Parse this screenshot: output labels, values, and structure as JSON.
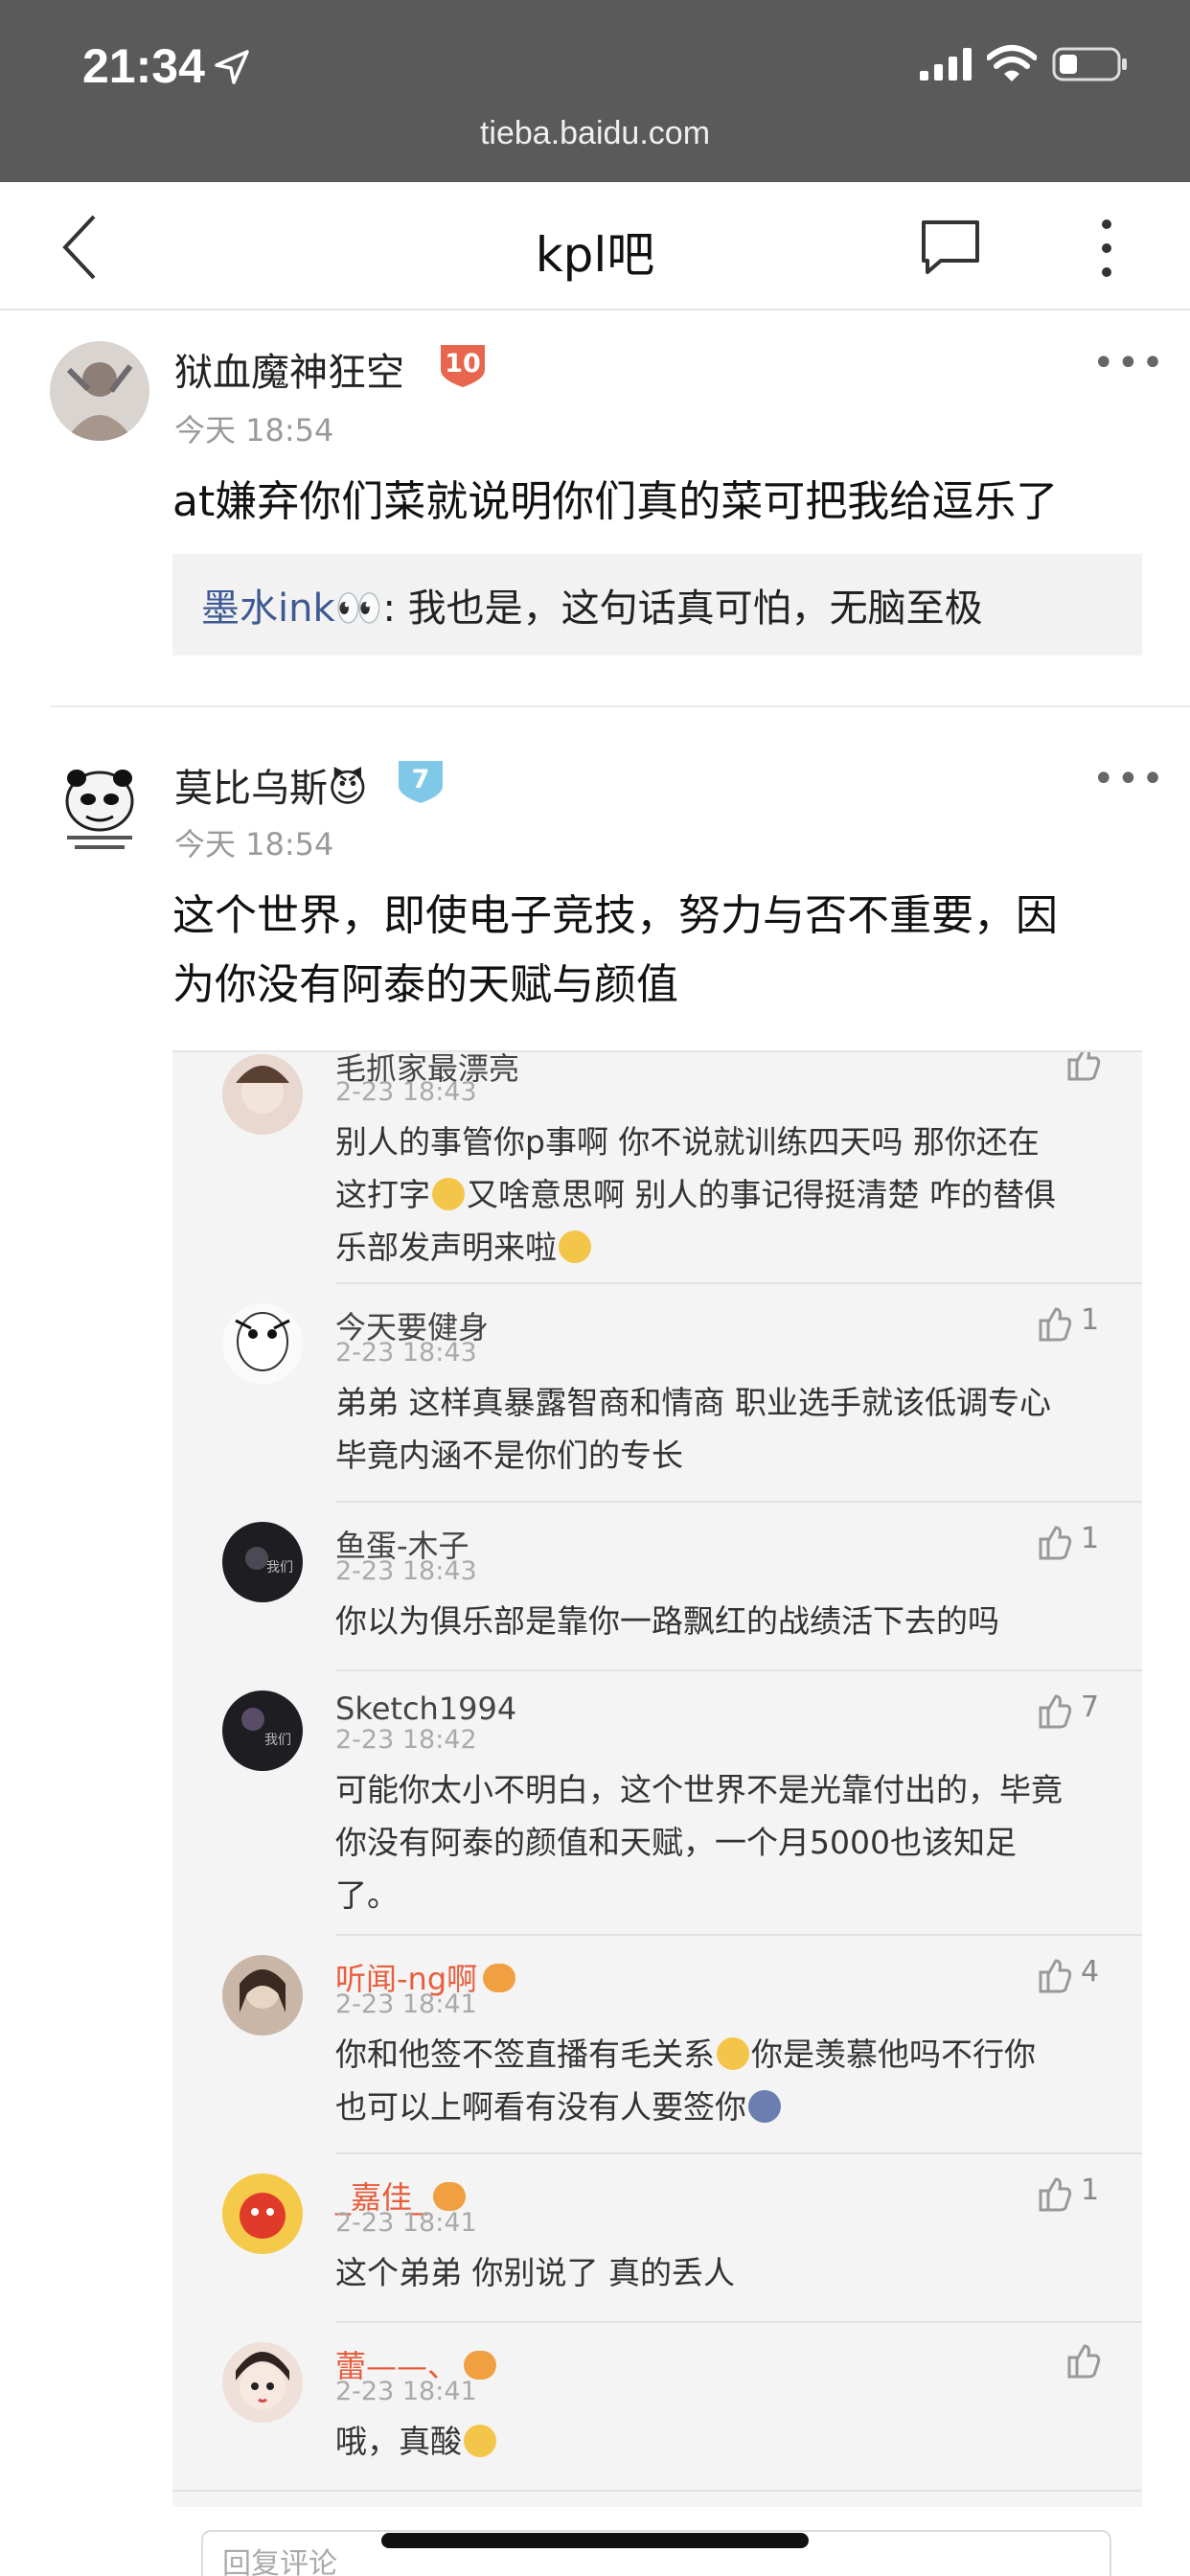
{
  "status_bar": {
    "time": "21:34",
    "url": "tieba.baidu.com"
  },
  "nav": {
    "title": "kpl吧"
  },
  "posts": [
    {
      "username": "狱血魔神狂空",
      "level": "10",
      "time": "今天 18:54",
      "text": "at嫌弃你们菜就说明你们真的菜可把我给逗乐了",
      "quote": {
        "name": "墨水ink👀",
        "text": ": 我也是，这句话真可怕，无脑至极"
      }
    },
    {
      "username": "莫比乌斯😈",
      "level": "7",
      "time": "今天 18:54",
      "text_line1": "这个世界，即使电子竞技，努力与否不重要，因",
      "text_line2": "为你没有阿泰的天赋与颜值"
    }
  ],
  "embedded_comments": [
    {
      "name": "毛抓家最漂亮",
      "time": "2-23 18:43",
      "likes": "",
      "lines": [
        "别人的事管你p事啊 你不说就训练四天吗 那你还在",
        "这打字",
        "又啥意思啊 别人的事记得挺清楚 咋的替俱",
        "乐部发声明来啦"
      ]
    },
    {
      "name": "今天要健身",
      "time": "2-23 18:43",
      "likes": "1",
      "lines": [
        "弟弟 这样真暴露智商和情商 职业选手就该低调专心",
        "毕竟内涵不是你们的专长"
      ]
    },
    {
      "name": "鱼蛋-木子",
      "time": "2-23 18:43",
      "likes": "1",
      "lines": [
        "你以为俱乐部是靠你一路飘红的战绩活下去的吗"
      ]
    },
    {
      "name": "Sketch1994",
      "time": "2-23 18:42",
      "likes": "7",
      "lines": [
        "可能你太小不明白，这个世界不是光靠付出的，毕竟",
        "你没有阿泰的颜值和天赋，一个月5000也该知足",
        "了。"
      ]
    },
    {
      "name": "听闻-ng啊",
      "time": "2-23 18:41",
      "likes": "4",
      "lines": [
        "你和他签不签直播有毛关系",
        "你是羡慕他吗不行你",
        "也可以上啊看有没有人要签你"
      ]
    },
    {
      "name": "_嘉佳_",
      "time": "2-23 18:41",
      "likes": "1",
      "lines": [
        "这个弟弟 你别说了 真的丢人"
      ]
    },
    {
      "name": "蕾——、",
      "time": "2-23 18:41",
      "likes": "",
      "lines": [
        "哦，真酸"
      ]
    }
  ],
  "reply_placeholder": "回复评论",
  "colors": {
    "status_bar_bg": "#5a5a5a",
    "level_red": "#e8664e",
    "level_blue": "#7fc8e8",
    "quote_name": "#3e5a94",
    "vip_name": "#e85d3c"
  }
}
